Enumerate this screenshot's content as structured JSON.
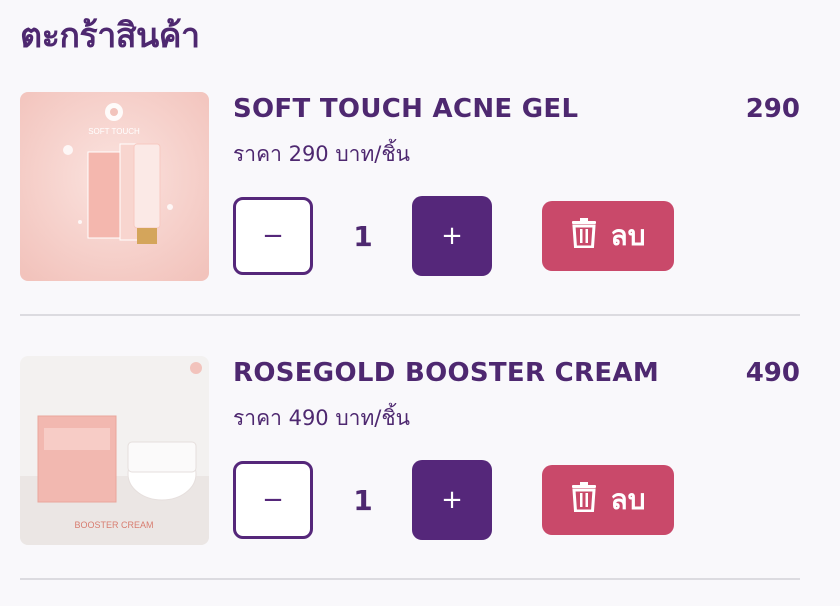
{
  "page": {
    "title": "ตะกร้าสินค้า"
  },
  "cart": {
    "items": [
      {
        "name": "SOFT TOUCH ACNE GEL",
        "unit_price_text": "ราคา 290 บาท/ชิ้น",
        "total": "290",
        "quantity": "1",
        "minus_label": "−",
        "plus_label": "+",
        "delete_label": "ลบ",
        "image_brand_text": "SOFT TOUCH"
      },
      {
        "name": "ROSEGOLD BOOSTER CREAM",
        "unit_price_text": "ราคา 490 บาท/ชิ้น",
        "total": "490",
        "quantity": "1",
        "minus_label": "−",
        "plus_label": "+",
        "delete_label": "ลบ",
        "image_brand_text": "BOOSTER CREAM"
      }
    ]
  },
  "icons": {
    "delete": "trash-icon",
    "minus": "minus-icon",
    "plus": "plus-icon"
  },
  "colors": {
    "primary": "#55277a",
    "danger": "#c9496a",
    "text": "#4e2870",
    "background": "#f9f8fb"
  }
}
